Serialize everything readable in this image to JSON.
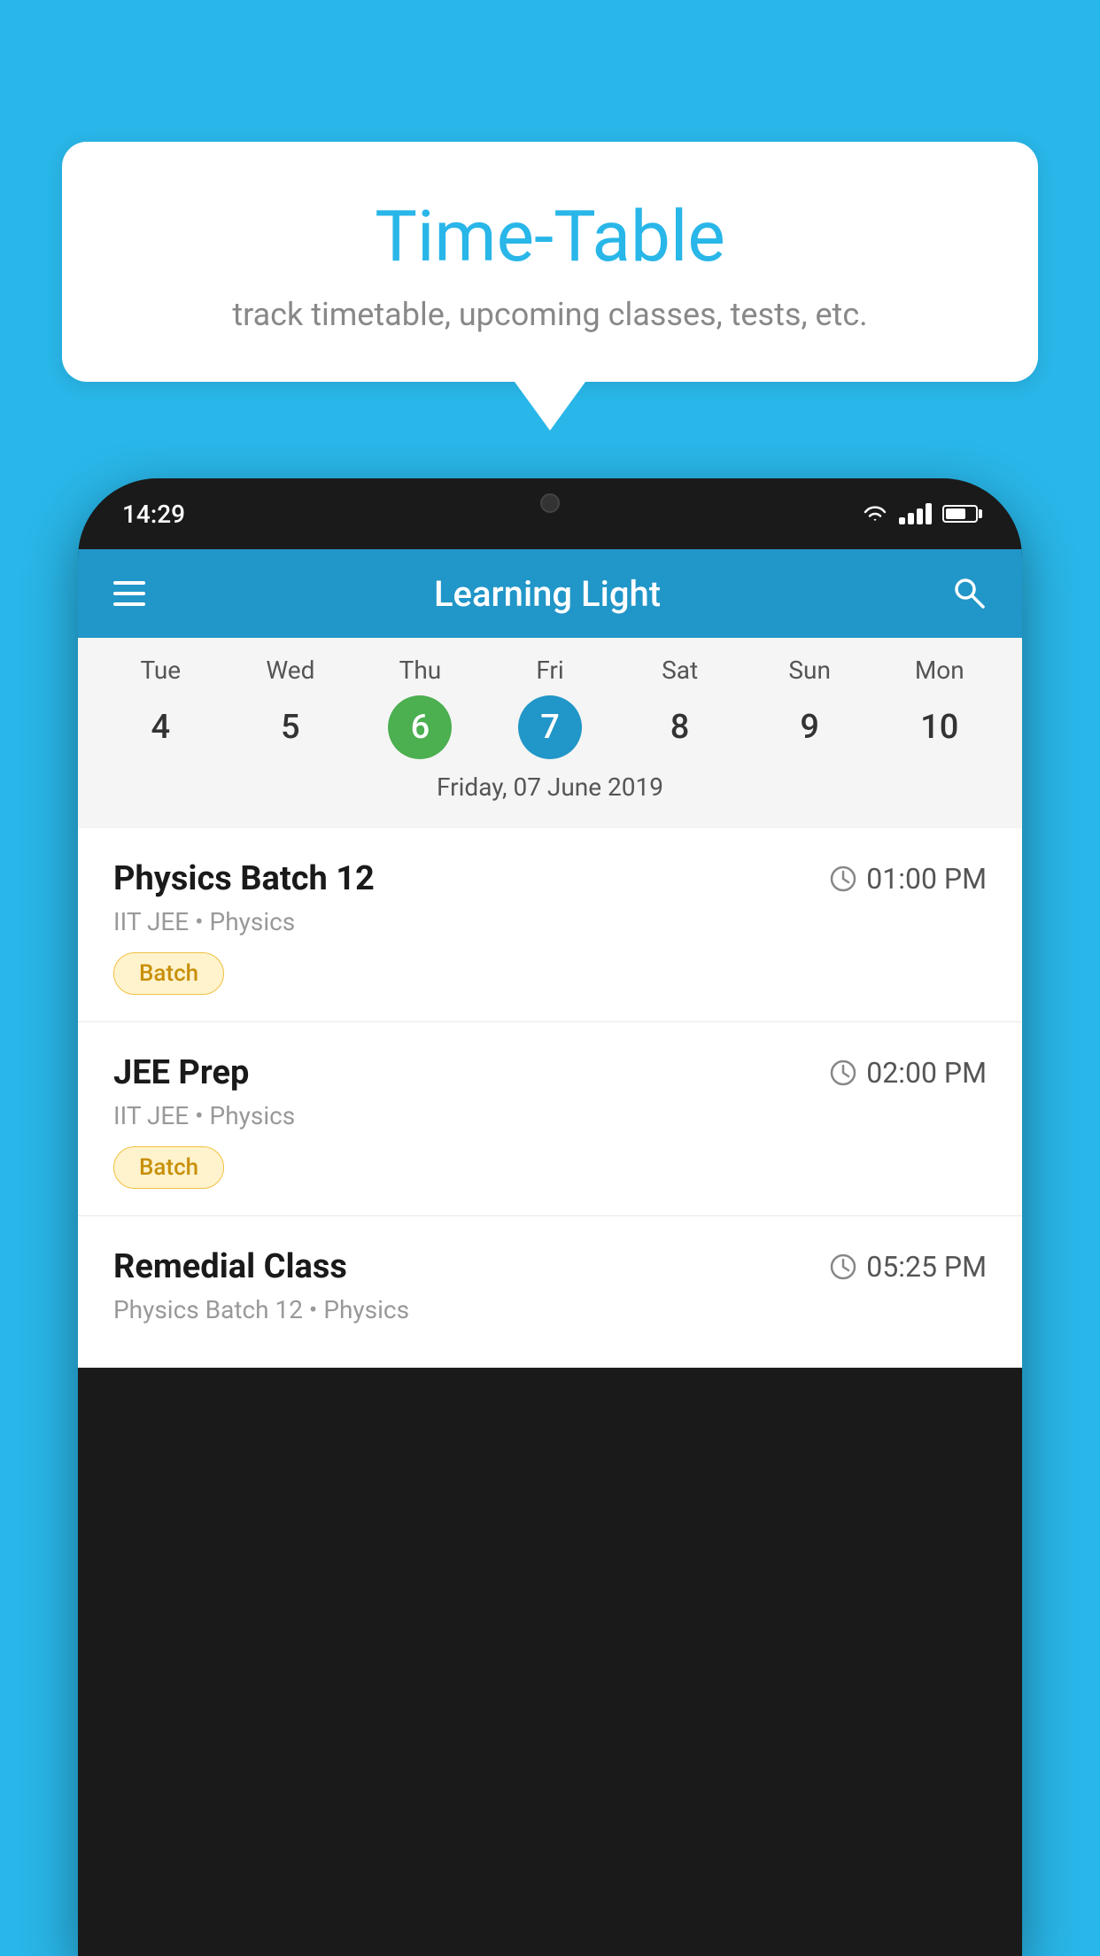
{
  "background_color": "#29B6E8",
  "speech_bubble": {
    "title": "Time-Table",
    "subtitle": "track timetable, upcoming classes, tests, etc."
  },
  "phone": {
    "status_bar": {
      "time": "14:29"
    },
    "app_header": {
      "title": "Learning Light"
    },
    "calendar": {
      "days": [
        {
          "label": "Tue",
          "number": "4"
        },
        {
          "label": "Wed",
          "number": "5"
        },
        {
          "label": "Thu",
          "number": "6",
          "state": "today"
        },
        {
          "label": "Fri",
          "number": "7",
          "state": "selected"
        },
        {
          "label": "Sat",
          "number": "8"
        },
        {
          "label": "Sun",
          "number": "9"
        },
        {
          "label": "Mon",
          "number": "10"
        }
      ],
      "selected_date_label": "Friday, 07 June 2019"
    },
    "schedule_items": [
      {
        "title": "Physics Batch 12",
        "time": "01:00 PM",
        "subtitle": "IIT JEE • Physics",
        "badge": "Batch"
      },
      {
        "title": "JEE Prep",
        "time": "02:00 PM",
        "subtitle": "IIT JEE • Physics",
        "badge": "Batch"
      },
      {
        "title": "Remedial Class",
        "time": "05:25 PM",
        "subtitle": "Physics Batch 12 • Physics",
        "badge": null
      }
    ]
  }
}
